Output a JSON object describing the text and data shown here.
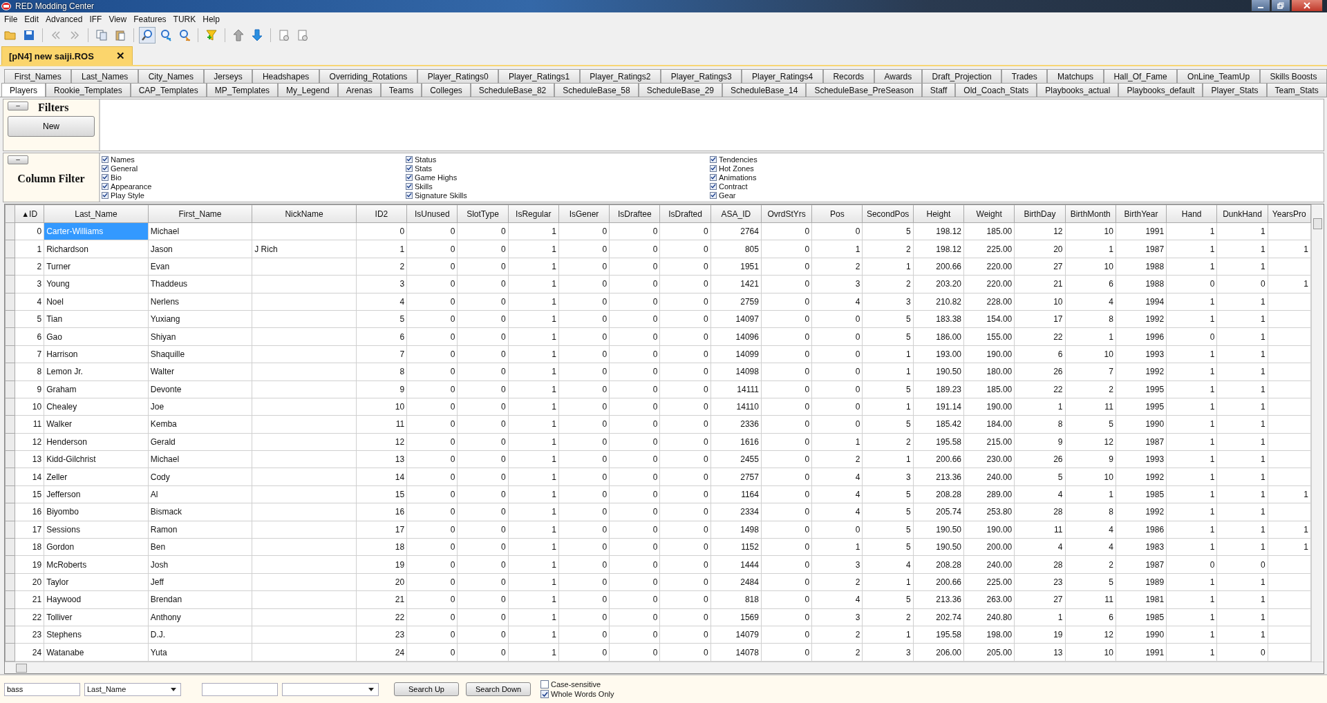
{
  "window": {
    "title": "RED Modding Center"
  },
  "menu": [
    "File",
    "Edit",
    "Advanced",
    "IFF",
    "View",
    "Features",
    "TURK",
    "Help"
  ],
  "document_tab": {
    "title": "[pN4] new saiji.ROS",
    "close": "✕"
  },
  "tab_rows": [
    {
      "tabs": [
        {
          "label": "First_Names",
          "selected": false
        },
        {
          "label": "Last_Names",
          "selected": false
        },
        {
          "label": "City_Names",
          "selected": false
        },
        {
          "label": "Jerseys",
          "selected": false
        },
        {
          "label": "Headshapes",
          "selected": false
        },
        {
          "label": "Overriding_Rotations",
          "selected": false
        },
        {
          "label": "Player_Ratings0",
          "selected": false
        },
        {
          "label": "Player_Ratings1",
          "selected": false
        },
        {
          "label": "Player_Ratings2",
          "selected": false
        },
        {
          "label": "Player_Ratings3",
          "selected": false
        },
        {
          "label": "Player_Ratings4",
          "selected": false
        },
        {
          "label": "Records",
          "selected": false
        },
        {
          "label": "Awards",
          "selected": false
        },
        {
          "label": "Draft_Projection",
          "selected": false
        },
        {
          "label": "Trades",
          "selected": false
        },
        {
          "label": "Matchups",
          "selected": false
        },
        {
          "label": "Hall_Of_Fame",
          "selected": false
        },
        {
          "label": "OnLine_TeamUp",
          "selected": false
        },
        {
          "label": "Skills Boosts",
          "selected": false
        }
      ]
    },
    {
      "tabs": [
        {
          "label": "Players",
          "selected": true
        },
        {
          "label": "Rookie_Templates",
          "selected": false
        },
        {
          "label": "CAP_Templates",
          "selected": false
        },
        {
          "label": "MP_Templates",
          "selected": false
        },
        {
          "label": "My_Legend",
          "selected": false
        },
        {
          "label": "Arenas",
          "selected": false
        },
        {
          "label": "Teams",
          "selected": false
        },
        {
          "label": "Colleges",
          "selected": false
        },
        {
          "label": "ScheduleBase_82",
          "selected": false
        },
        {
          "label": "ScheduleBase_58",
          "selected": false
        },
        {
          "label": "ScheduleBase_29",
          "selected": false
        },
        {
          "label": "ScheduleBase_14",
          "selected": false
        },
        {
          "label": "ScheduleBase_PreSeason",
          "selected": false
        },
        {
          "label": "Staff",
          "selected": false
        },
        {
          "label": "Old_Coach_Stats",
          "selected": false
        },
        {
          "label": "Playbooks_actual",
          "selected": false
        },
        {
          "label": "Playbooks_default",
          "selected": false
        },
        {
          "label": "Player_Stats",
          "selected": false
        },
        {
          "label": "Team_Stats",
          "selected": false
        }
      ]
    }
  ],
  "filters": {
    "collapse": "–",
    "title": "Filters",
    "new_button": "New"
  },
  "column_filter": {
    "collapse": "–",
    "title": "Column Filter",
    "groups": [
      [
        {
          "label": "Names",
          "checked": true
        },
        {
          "label": "General",
          "checked": true
        },
        {
          "label": "Bio",
          "checked": true
        },
        {
          "label": "Appearance",
          "checked": true
        },
        {
          "label": "Play Style",
          "checked": true
        }
      ],
      [
        {
          "label": "Status",
          "checked": true
        },
        {
          "label": "Stats",
          "checked": true
        },
        {
          "label": "Game Highs",
          "checked": true
        },
        {
          "label": "Skills",
          "checked": true
        },
        {
          "label": "Signature Skills",
          "checked": true
        }
      ],
      [
        {
          "label": "Tendencies",
          "checked": true
        },
        {
          "label": "Hot Zones",
          "checked": true
        },
        {
          "label": "Animations",
          "checked": true
        },
        {
          "label": "Contract",
          "checked": true
        },
        {
          "label": "Gear",
          "checked": true
        }
      ]
    ]
  },
  "table": {
    "columns": [
      {
        "label": "ID",
        "sort": "▲"
      },
      {
        "label": "Last_Name"
      },
      {
        "label": "First_Name"
      },
      {
        "label": "NickName"
      },
      {
        "label": "ID2"
      },
      {
        "label": "IsUnused"
      },
      {
        "label": "SlotType"
      },
      {
        "label": "IsRegular"
      },
      {
        "label": "IsGener"
      },
      {
        "label": "IsDraftee"
      },
      {
        "label": "IsDrafted"
      },
      {
        "label": "ASA_ID"
      },
      {
        "label": "OvrdStYrs"
      },
      {
        "label": "Pos"
      },
      {
        "label": "SecondPos"
      },
      {
        "label": "Height"
      },
      {
        "label": "Weight"
      },
      {
        "label": "BirthDay"
      },
      {
        "label": "BirthMonth"
      },
      {
        "label": "BirthYear"
      },
      {
        "label": "Hand"
      },
      {
        "label": "DunkHand"
      },
      {
        "label": "YearsPro"
      }
    ],
    "rows": [
      {
        "selected": true,
        "cells": [
          "0",
          "Carter-Williams",
          "Michael",
          "",
          "0",
          "0",
          "0",
          "1",
          "0",
          "0",
          "0",
          "2764",
          "0",
          "0",
          "5",
          "198.12",
          "185.00",
          "12",
          "10",
          "1991",
          "1",
          "1"
        ]
      },
      {
        "selected": false,
        "cells": [
          "1",
          "Richardson",
          "Jason",
          "J Rich",
          "1",
          "0",
          "0",
          "1",
          "0",
          "0",
          "0",
          "805",
          "0",
          "1",
          "2",
          "198.12",
          "225.00",
          "20",
          "1",
          "1987",
          "1",
          "1",
          "1"
        ]
      },
      {
        "selected": false,
        "cells": [
          "2",
          "Turner",
          "Evan",
          "",
          "2",
          "0",
          "0",
          "1",
          "0",
          "0",
          "0",
          "1951",
          "0",
          "2",
          "1",
          "200.66",
          "220.00",
          "27",
          "10",
          "1988",
          "1",
          "1"
        ]
      },
      {
        "selected": false,
        "cells": [
          "3",
          "Young",
          "Thaddeus",
          "",
          "3",
          "0",
          "0",
          "1",
          "0",
          "0",
          "0",
          "1421",
          "0",
          "3",
          "2",
          "203.20",
          "220.00",
          "21",
          "6",
          "1988",
          "0",
          "0",
          "1"
        ]
      },
      {
        "selected": false,
        "cells": [
          "4",
          "Noel",
          "Nerlens",
          "",
          "4",
          "0",
          "0",
          "1",
          "0",
          "0",
          "0",
          "2759",
          "0",
          "4",
          "3",
          "210.82",
          "228.00",
          "10",
          "4",
          "1994",
          "1",
          "1"
        ]
      },
      {
        "selected": false,
        "cells": [
          "5",
          "Tian",
          "Yuxiang",
          "",
          "5",
          "0",
          "0",
          "1",
          "0",
          "0",
          "0",
          "14097",
          "0",
          "0",
          "5",
          "183.38",
          "154.00",
          "17",
          "8",
          "1992",
          "1",
          "1"
        ]
      },
      {
        "selected": false,
        "cells": [
          "6",
          "Gao",
          "Shiyan",
          "",
          "6",
          "0",
          "0",
          "1",
          "0",
          "0",
          "0",
          "14096",
          "0",
          "0",
          "5",
          "186.00",
          "155.00",
          "22",
          "1",
          "1996",
          "0",
          "1"
        ]
      },
      {
        "selected": false,
        "cells": [
          "7",
          "Harrison",
          "Shaquille",
          "",
          "7",
          "0",
          "0",
          "1",
          "0",
          "0",
          "0",
          "14099",
          "0",
          "0",
          "1",
          "193.00",
          "190.00",
          "6",
          "10",
          "1993",
          "1",
          "1"
        ]
      },
      {
        "selected": false,
        "cells": [
          "8",
          "Lemon Jr.",
          "Walter",
          "",
          "8",
          "0",
          "0",
          "1",
          "0",
          "0",
          "0",
          "14098",
          "0",
          "0",
          "1",
          "190.50",
          "180.00",
          "26",
          "7",
          "1992",
          "1",
          "1"
        ]
      },
      {
        "selected": false,
        "cells": [
          "9",
          "Graham",
          "Devonte",
          "",
          "9",
          "0",
          "0",
          "1",
          "0",
          "0",
          "0",
          "14111",
          "0",
          "0",
          "5",
          "189.23",
          "185.00",
          "22",
          "2",
          "1995",
          "1",
          "1"
        ]
      },
      {
        "selected": false,
        "cells": [
          "10",
          "Chealey",
          "Joe",
          "",
          "10",
          "0",
          "0",
          "1",
          "0",
          "0",
          "0",
          "14110",
          "0",
          "0",
          "1",
          "191.14",
          "190.00",
          "1",
          "11",
          "1995",
          "1",
          "1"
        ]
      },
      {
        "selected": false,
        "cells": [
          "11",
          "Walker",
          "Kemba",
          "",
          "11",
          "0",
          "0",
          "1",
          "0",
          "0",
          "0",
          "2336",
          "0",
          "0",
          "5",
          "185.42",
          "184.00",
          "8",
          "5",
          "1990",
          "1",
          "1"
        ]
      },
      {
        "selected": false,
        "cells": [
          "12",
          "Henderson",
          "Gerald",
          "",
          "12",
          "0",
          "0",
          "1",
          "0",
          "0",
          "0",
          "1616",
          "0",
          "1",
          "2",
          "195.58",
          "215.00",
          "9",
          "12",
          "1987",
          "1",
          "1"
        ]
      },
      {
        "selected": false,
        "cells": [
          "13",
          "Kidd-Gilchrist",
          "Michael",
          "",
          "13",
          "0",
          "0",
          "1",
          "0",
          "0",
          "0",
          "2455",
          "0",
          "2",
          "1",
          "200.66",
          "230.00",
          "26",
          "9",
          "1993",
          "1",
          "1"
        ]
      },
      {
        "selected": false,
        "cells": [
          "14",
          "Zeller",
          "Cody",
          "",
          "14",
          "0",
          "0",
          "1",
          "0",
          "0",
          "0",
          "2757",
          "0",
          "4",
          "3",
          "213.36",
          "240.00",
          "5",
          "10",
          "1992",
          "1",
          "1"
        ]
      },
      {
        "selected": false,
        "cells": [
          "15",
          "Jefferson",
          "Al",
          "",
          "15",
          "0",
          "0",
          "1",
          "0",
          "0",
          "0",
          "1164",
          "0",
          "4",
          "5",
          "208.28",
          "289.00",
          "4",
          "1",
          "1985",
          "1",
          "1",
          "1"
        ]
      },
      {
        "selected": false,
        "cells": [
          "16",
          "Biyombo",
          "Bismack",
          "",
          "16",
          "0",
          "0",
          "1",
          "0",
          "0",
          "0",
          "2334",
          "0",
          "4",
          "5",
          "205.74",
          "253.80",
          "28",
          "8",
          "1992",
          "1",
          "1"
        ]
      },
      {
        "selected": false,
        "cells": [
          "17",
          "Sessions",
          "Ramon",
          "",
          "17",
          "0",
          "0",
          "1",
          "0",
          "0",
          "0",
          "1498",
          "0",
          "0",
          "5",
          "190.50",
          "190.00",
          "11",
          "4",
          "1986",
          "1",
          "1",
          "1"
        ]
      },
      {
        "selected": false,
        "cells": [
          "18",
          "Gordon",
          "Ben",
          "",
          "18",
          "0",
          "0",
          "1",
          "0",
          "0",
          "0",
          "1152",
          "0",
          "1",
          "5",
          "190.50",
          "200.00",
          "4",
          "4",
          "1983",
          "1",
          "1",
          "1"
        ]
      },
      {
        "selected": false,
        "cells": [
          "19",
          "McRoberts",
          "Josh",
          "",
          "19",
          "0",
          "0",
          "1",
          "0",
          "0",
          "0",
          "1444",
          "0",
          "3",
          "4",
          "208.28",
          "240.00",
          "28",
          "2",
          "1987",
          "0",
          "0"
        ]
      },
      {
        "selected": false,
        "cells": [
          "20",
          "Taylor",
          "Jeff",
          "",
          "20",
          "0",
          "0",
          "1",
          "0",
          "0",
          "0",
          "2484",
          "0",
          "2",
          "1",
          "200.66",
          "225.00",
          "23",
          "5",
          "1989",
          "1",
          "1"
        ]
      },
      {
        "selected": false,
        "cells": [
          "21",
          "Haywood",
          "Brendan",
          "",
          "21",
          "0",
          "0",
          "1",
          "0",
          "0",
          "0",
          "818",
          "0",
          "4",
          "5",
          "213.36",
          "263.00",
          "27",
          "11",
          "1981",
          "1",
          "1"
        ]
      },
      {
        "selected": false,
        "cells": [
          "22",
          "Tolliver",
          "Anthony",
          "",
          "22",
          "0",
          "0",
          "1",
          "0",
          "0",
          "0",
          "1569",
          "0",
          "3",
          "2",
          "202.74",
          "240.80",
          "1",
          "6",
          "1985",
          "1",
          "1"
        ]
      },
      {
        "selected": false,
        "cells": [
          "23",
          "Stephens",
          "D.J.",
          "",
          "23",
          "0",
          "0",
          "1",
          "0",
          "0",
          "0",
          "14079",
          "0",
          "2",
          "1",
          "195.58",
          "198.00",
          "19",
          "12",
          "1990",
          "1",
          "1"
        ]
      },
      {
        "selected": false,
        "cells": [
          "24",
          "Watanabe",
          "Yuta",
          "",
          "24",
          "0",
          "0",
          "1",
          "0",
          "0",
          "0",
          "14078",
          "0",
          "2",
          "3",
          "206.00",
          "205.00",
          "13",
          "10",
          "1991",
          "1",
          "0"
        ]
      }
    ]
  },
  "search_bar": {
    "query": "bass",
    "column": "Last_Name",
    "search_up": "Search Up",
    "search_down": "Search Down",
    "options": [
      {
        "label": "Case-sensitive",
        "checked": false
      },
      {
        "label": "Whole Words Only",
        "checked": true
      }
    ]
  }
}
